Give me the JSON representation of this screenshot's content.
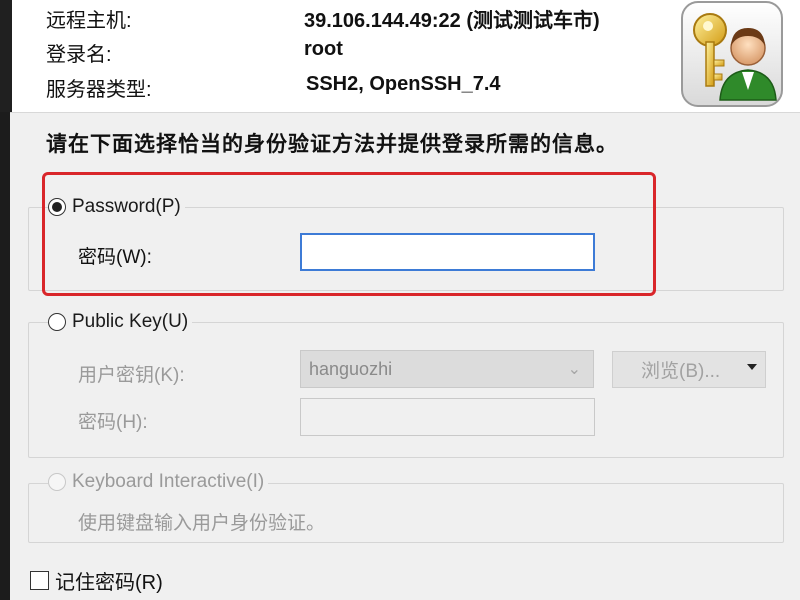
{
  "header": {
    "remote_host_label": "远程主机:",
    "remote_host_value": "39.106.144.49:22 (测试测试车市)",
    "login_label": "登录名:",
    "login_value": "root",
    "server_type_label": "服务器类型:",
    "server_type_value": "SSH2, OpenSSH_7.4",
    "icon": "key-user-icon"
  },
  "instruction": "请在下面选择恰当的身份验证方法并提供登录所需的信息。",
  "password_group": {
    "radio_label": "Password(P)",
    "selected": true,
    "password_label": "密码(W):",
    "password_value": ""
  },
  "publickey_group": {
    "radio_label": "Public Key(U)",
    "selected": false,
    "user_key_label": "用户密钥(K):",
    "user_key_value": "hanguozhi",
    "browse_label": "浏览(B)...",
    "passphrase_label": "密码(H):",
    "passphrase_value": ""
  },
  "keyboard_group": {
    "radio_label": "Keyboard Interactive(I)",
    "selected": false,
    "hint": "使用键盘输入用户身份验证。"
  },
  "remember_password": {
    "label": "记住密码(R)",
    "checked": false
  },
  "colors": {
    "highlight": "#d9262a",
    "active_border": "#3d7bd6",
    "dialog_bg": "#f0f0f0"
  }
}
